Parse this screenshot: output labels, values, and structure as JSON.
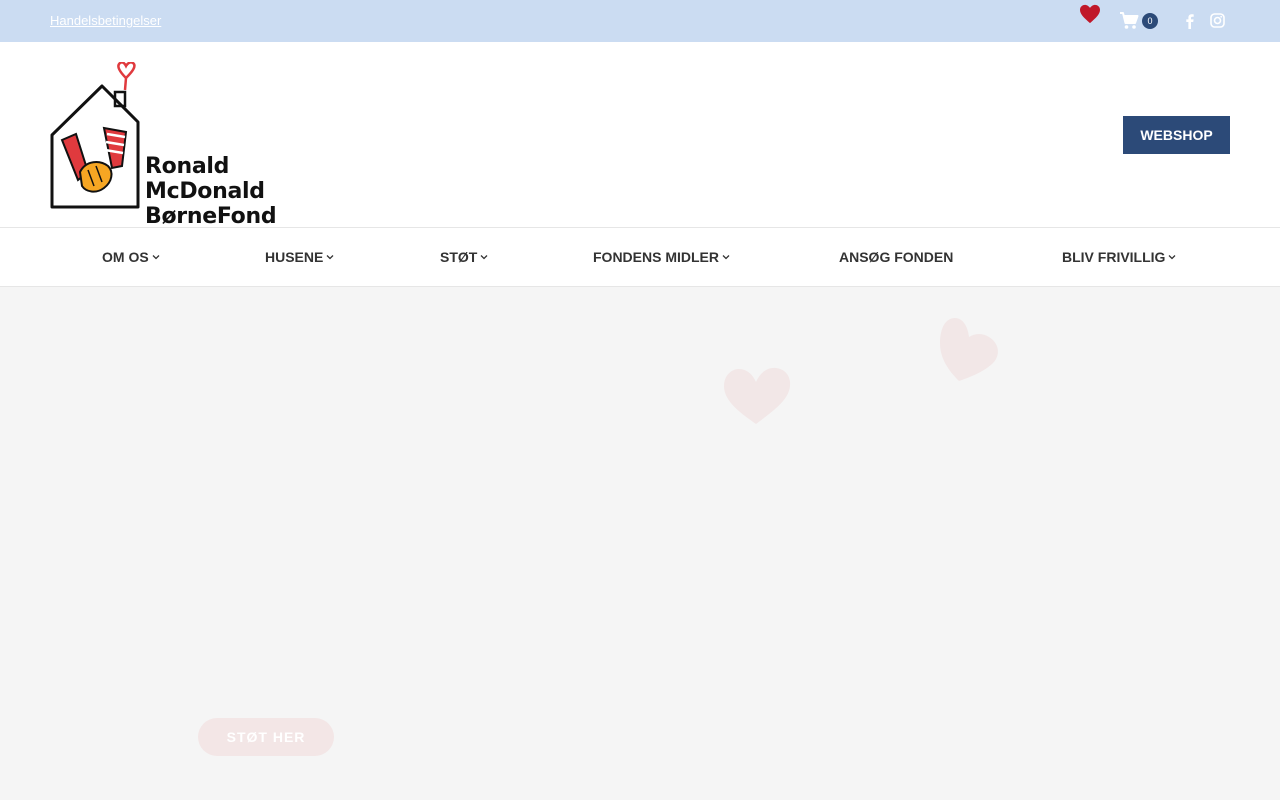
{
  "topbar": {
    "terms_link": "Handelsbetingelser",
    "cart_count": "0",
    "icons": [
      "heart-icon",
      "cart-icon",
      "facebook-icon",
      "instagram-icon"
    ]
  },
  "header": {
    "logo_line1": "Ronald McDonald",
    "logo_line2": "BørneFond",
    "webshop_label": "WEBSHOP"
  },
  "nav": {
    "items": [
      {
        "label": "OM OS",
        "dropdown": true
      },
      {
        "label": "HUSENE",
        "dropdown": true
      },
      {
        "label": "STØT",
        "dropdown": true
      },
      {
        "label": "FONDENS MIDLER",
        "dropdown": true
      },
      {
        "label": "ANSØG FONDEN",
        "dropdown": false
      },
      {
        "label": "BLIV FRIVILLIG",
        "dropdown": true
      }
    ]
  },
  "hero": {
    "cta_label": "STØT HER"
  },
  "colors": {
    "topbar_bg": "#cbdcf2",
    "accent_navy": "#2c4a78",
    "heart_red": "#c0182a",
    "hero_bg": "#f5f5f5"
  }
}
